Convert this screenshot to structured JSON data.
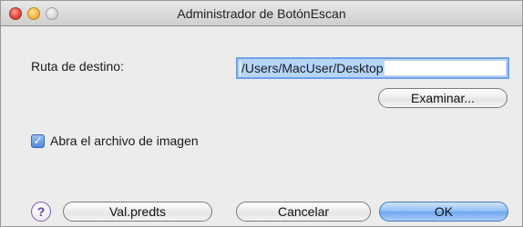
{
  "window": {
    "title": "Administrador de BotónEscan"
  },
  "form": {
    "destination_label": "Ruta de destino:",
    "destination_value": "/Users/MacUser/Desktop",
    "browse_label": "Examinar...",
    "open_image_label": "Abra el archivo de imagen",
    "open_image_checked": true
  },
  "footer": {
    "help_glyph": "?",
    "defaults_label": "Val.predts",
    "cancel_label": "Cancelar",
    "ok_label": "OK"
  },
  "icons": {
    "checkbox_check": "check-icon",
    "help": "help-icon"
  },
  "colors": {
    "focus": "#6ea1e8",
    "default_button": "#8fbcf5",
    "close": "#e0443a",
    "minimize": "#f5b73a"
  }
}
